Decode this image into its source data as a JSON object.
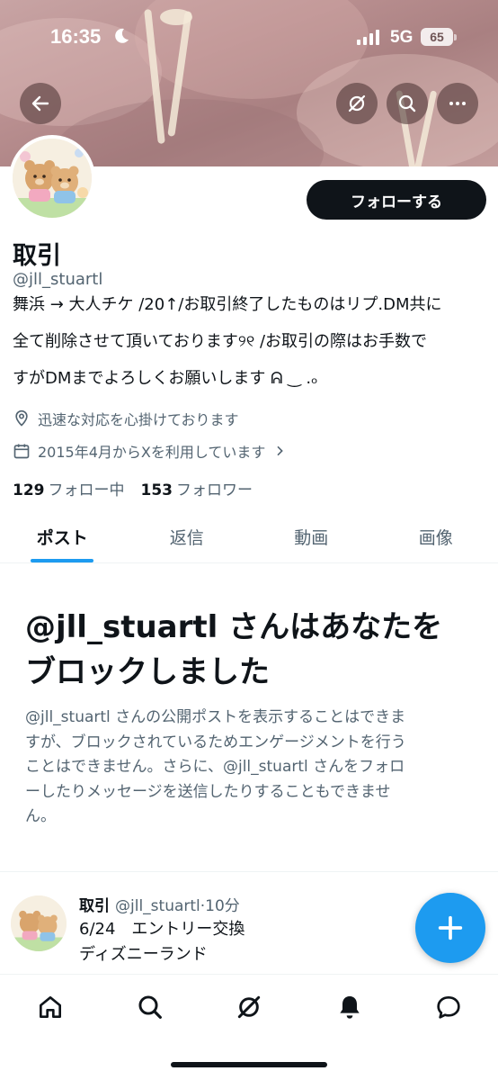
{
  "status_bar": {
    "time": "16:35",
    "network": "5G",
    "battery": "65"
  },
  "profile": {
    "display_name": "取引",
    "handle": "@jll_stuartl",
    "follow_label": "フォローする",
    "bio_lines": [
      "舞浜 → 大人チケ /20↑/お取引終了したものはリプ.DM共に",
      "全て削除させて頂いております୨୧ /お取引の際はお手数で",
      "すがDMまでよろしくお願いします ᕱ ‿ .ₒ"
    ],
    "location": "迅速な対応を心掛けております",
    "joined": "2015年4月からXを利用しています",
    "following_count": "129",
    "following_label": "フォロー中",
    "followers_count": "153",
    "followers_label": "フォロワー"
  },
  "tabs": [
    {
      "label": "ポスト",
      "active": true
    },
    {
      "label": "返信",
      "active": false
    },
    {
      "label": "動画",
      "active": false
    },
    {
      "label": "画像",
      "active": false
    }
  ],
  "blocked": {
    "title_lines": [
      "@jll_stuartl さんはあなたを",
      "ブロックしました"
    ],
    "description_lines": [
      "@jll_stuartl さんの公開ポストを表示することはできま",
      "すが、ブロックされているためエンゲージメントを行う",
      "ことはできません。さらに、@jll_stuartl さんをフォロ",
      "ーしたりメッセージを送信したりすることもできませ",
      "ん。"
    ]
  },
  "post": {
    "name": "取引",
    "handle": "@jll_stuartl",
    "time": "·10分",
    "lines": [
      "6/24　エントリー交換",
      "ディズニーランド"
    ]
  },
  "icons": {
    "back": "arrow-left-icon",
    "grok": "grok-icon",
    "search": "search-icon",
    "more": "more-icon",
    "location": "location-pin-icon",
    "calendar": "calendar-icon",
    "compose": "plus-icon",
    "nav": [
      "home-icon",
      "search-icon",
      "grok-icon",
      "bell-icon",
      "message-icon"
    ]
  },
  "colors": {
    "accent": "#1d9bf0",
    "text": "#0f1419",
    "secondary": "#536471"
  }
}
